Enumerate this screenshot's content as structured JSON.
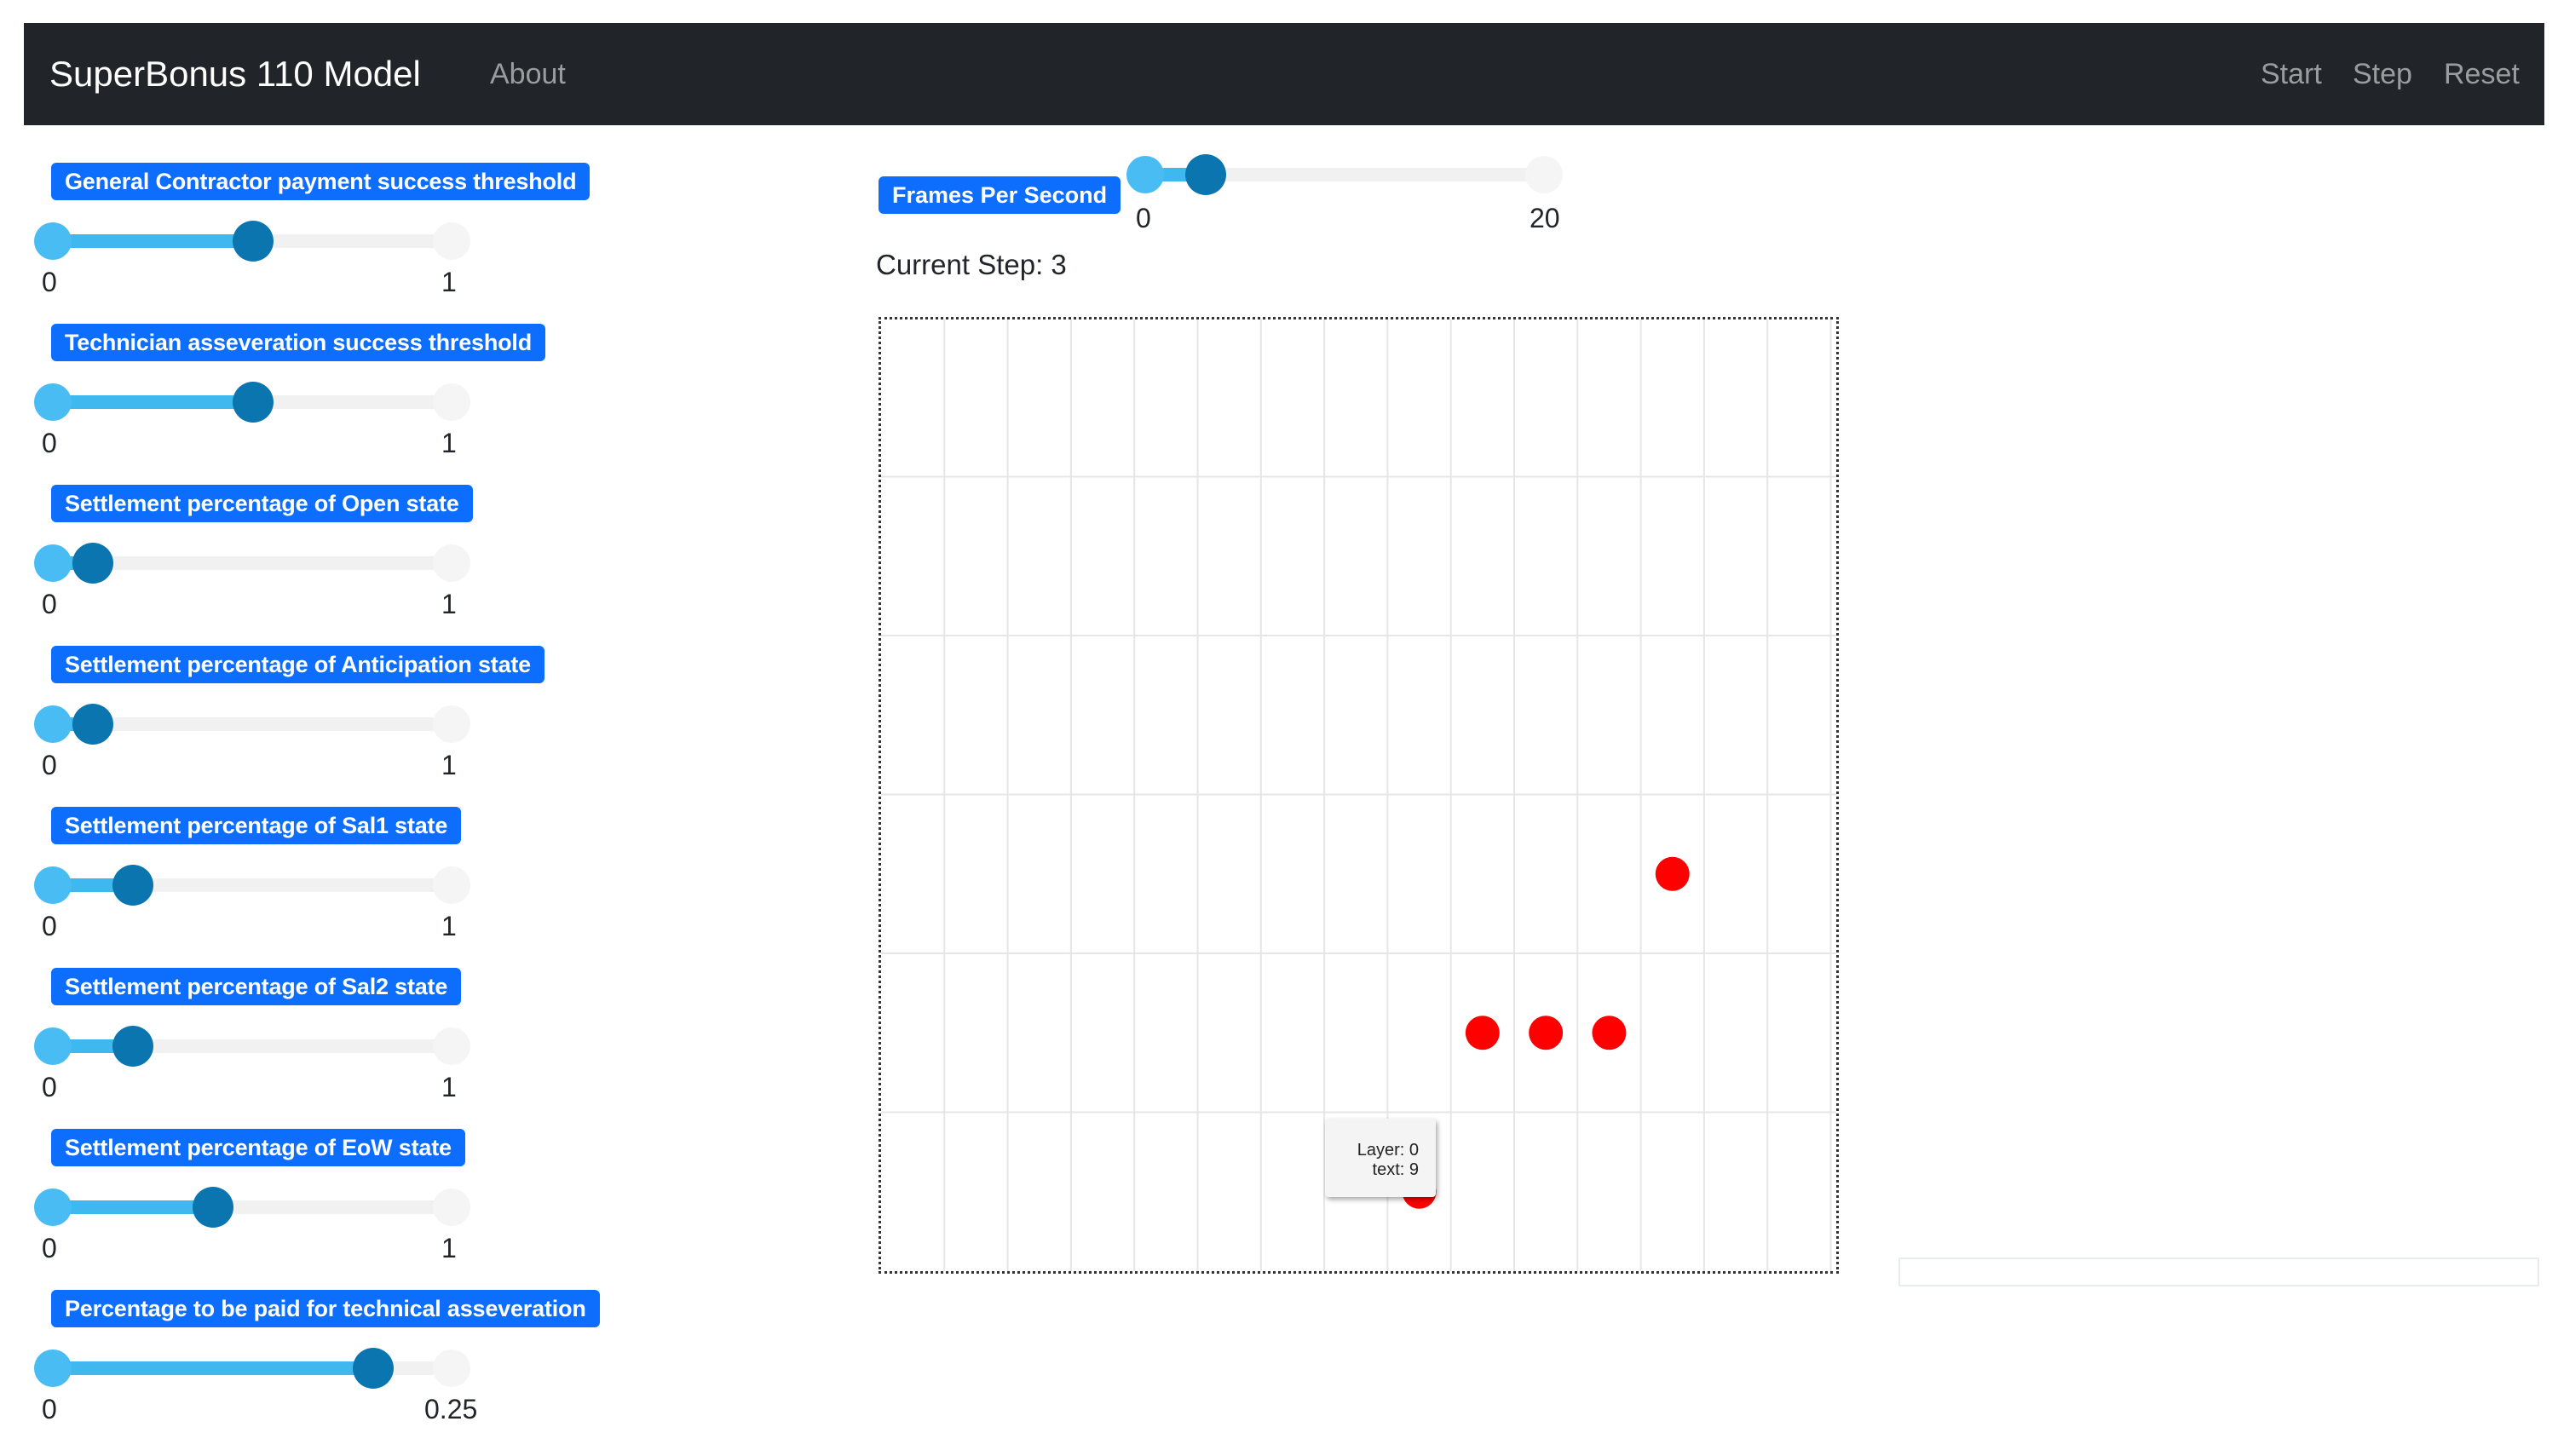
{
  "navbar": {
    "brand": "SuperBonus 110 Model",
    "about": "About",
    "start": "Start",
    "step": "Step",
    "reset": "Reset"
  },
  "params": [
    {
      "label": "General Contractor payment success threshold",
      "min": "0",
      "max": "1",
      "value": 0.5
    },
    {
      "label": "Technician asseveration success threshold",
      "min": "0",
      "max": "1",
      "value": 0.5
    },
    {
      "label": "Settlement percentage of Open state",
      "min": "0",
      "max": "1",
      "value": 0.1
    },
    {
      "label": "Settlement percentage of Anticipation state",
      "min": "0",
      "max": "1",
      "value": 0.1
    },
    {
      "label": "Settlement percentage of Sal1 state",
      "min": "0",
      "max": "1",
      "value": 0.2
    },
    {
      "label": "Settlement percentage of Sal2 state",
      "min": "0",
      "max": "1",
      "value": 0.2
    },
    {
      "label": "Settlement percentage of EoW state",
      "min": "0",
      "max": "1",
      "value": 0.4
    },
    {
      "label": "Percentage to be paid for technical asseveration",
      "min": "0",
      "max": "0.25",
      "value": 0.2
    }
  ],
  "fps": {
    "label": "Frames Per Second",
    "min": "0",
    "max": "20",
    "value": 3
  },
  "status": {
    "current_step": "Current Step: 3"
  },
  "grid": {
    "cols": 15,
    "rows": 6,
    "agent_color": "#ff0000",
    "agents": [
      {
        "col": 12,
        "row": 3
      },
      {
        "col": 9,
        "row": 4
      },
      {
        "col": 10,
        "row": 4
      },
      {
        "col": 11,
        "row": 4
      },
      {
        "col": 8,
        "row": 5
      }
    ]
  },
  "tooltip": {
    "line1": "Layer: 0",
    "line2": "text: 9"
  },
  "colors": {
    "navbar": "#212529",
    "badge": "#0d6efd",
    "slider_fill": "#3fb7ef",
    "slider_knob": "#0b75b0"
  }
}
